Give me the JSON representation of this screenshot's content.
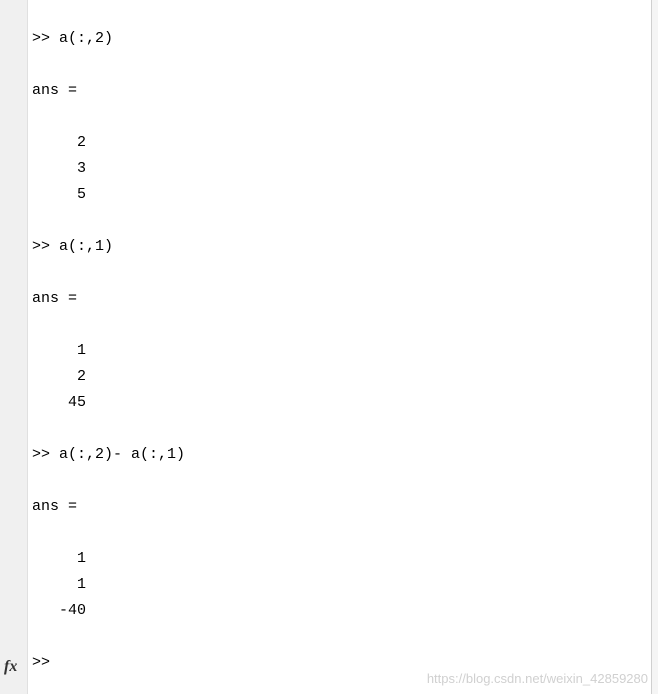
{
  "commands": {
    "cmd1": ">> a(:,2)",
    "cmd2": ">> a(:,1)",
    "cmd3": ">> a(:,2)- a(:,1)",
    "prompt": ">> "
  },
  "outputs": {
    "ans_label": "ans =",
    "result1": {
      "v1": "     2",
      "v2": "     3",
      "v3": "     5"
    },
    "result2": {
      "v1": "     1",
      "v2": "     2",
      "v3": "    45"
    },
    "result3": {
      "v1": "     1",
      "v2": "     1",
      "v3": "   -40"
    }
  },
  "fx_label": "fx",
  "watermark": "https://blog.csdn.net/weixin_42859280"
}
